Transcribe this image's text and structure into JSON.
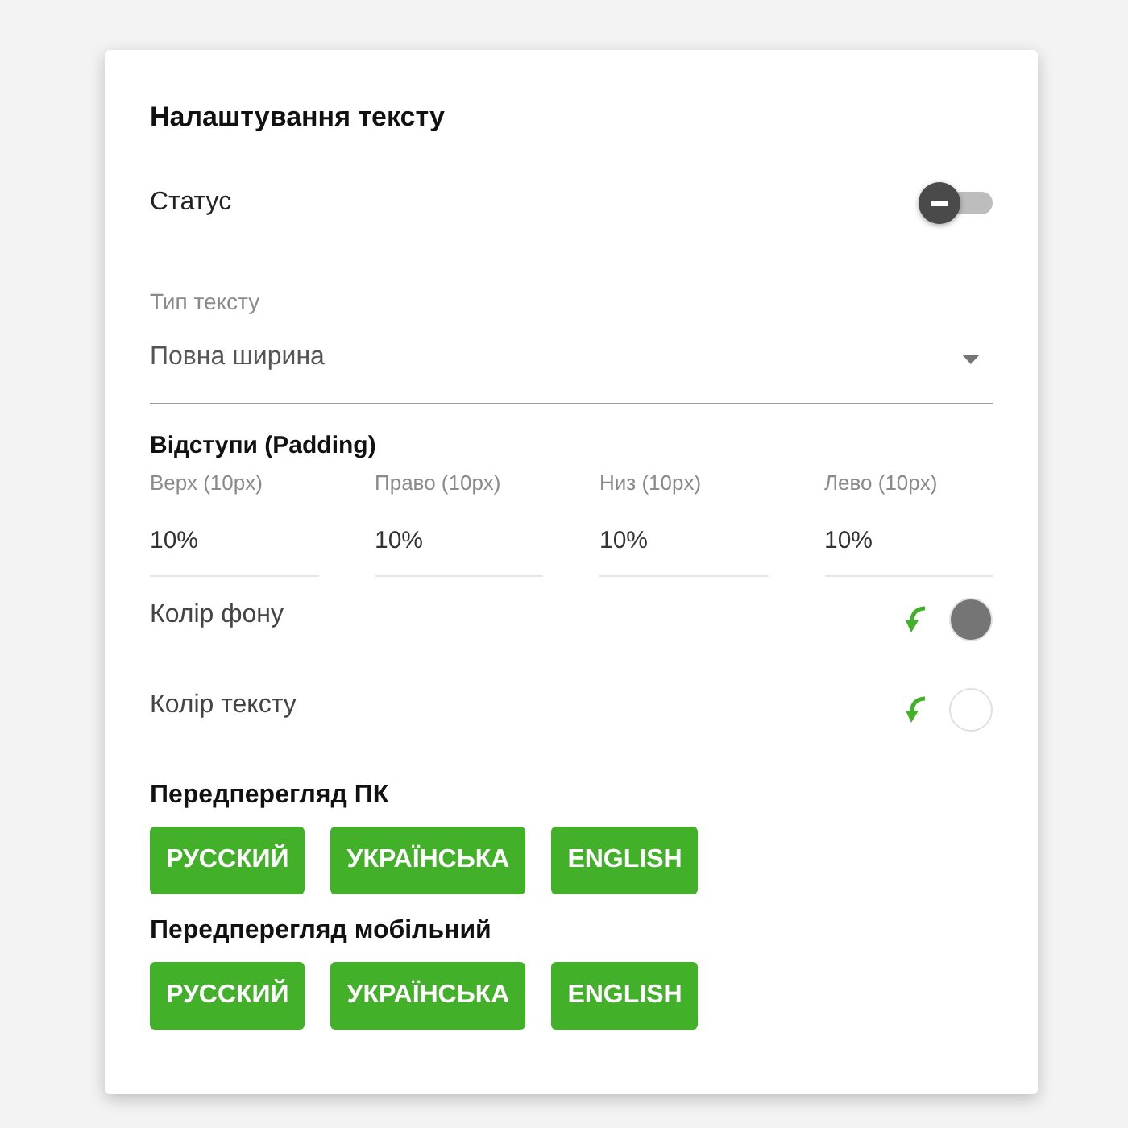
{
  "panel": {
    "title": "Налаштування тексту"
  },
  "status": {
    "label": "Статус",
    "on": false
  },
  "text_type": {
    "label": "Тип тексту",
    "value": "Повна ширина"
  },
  "padding": {
    "title": "Відступи (Padding)",
    "fields": [
      {
        "label": "Верх (10px)",
        "value": "10%"
      },
      {
        "label": "Право (10px)",
        "value": "10%"
      },
      {
        "label": "Низ (10px)",
        "value": "10%"
      },
      {
        "label": "Лево (10px)",
        "value": "10%"
      }
    ]
  },
  "colors": [
    {
      "label": "Колір фону",
      "color": "#757575"
    },
    {
      "label": "Колір тексту",
      "color": "#ffffff"
    }
  ],
  "previews": [
    {
      "title": "Передперегляд ПК",
      "buttons": [
        "РУССКИЙ",
        "УКРАЇНСЬКА",
        "ENGLISH"
      ]
    },
    {
      "title": "Передперегляд мобільний",
      "buttons": [
        "РУССКИЙ",
        "УКРАЇНСЬКА",
        "ENGLISH"
      ]
    }
  ]
}
